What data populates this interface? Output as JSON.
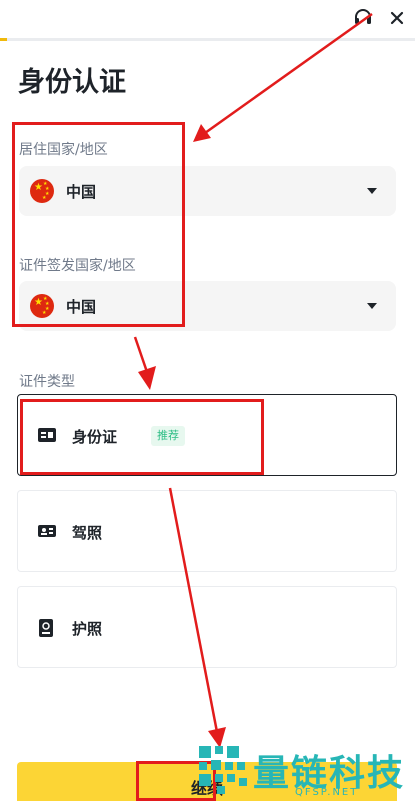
{
  "header": {
    "support_icon": "headset-icon",
    "close_icon": "close-icon",
    "progress_fraction": 0.02
  },
  "page": {
    "title": "身份认证"
  },
  "residence": {
    "label": "居住国家/地区",
    "value": "中国",
    "flag_icon": "china-flag-icon"
  },
  "issuing": {
    "label": "证件签发国家/地区",
    "value": "中国",
    "flag_icon": "china-flag-icon"
  },
  "doc_type": {
    "label": "证件类型",
    "options": [
      {
        "label": "身份证",
        "icon": "id-card-icon",
        "badge": "推荐",
        "selected": true
      },
      {
        "label": "驾照",
        "icon": "driver-license-icon",
        "selected": false
      },
      {
        "label": "护照",
        "icon": "passport-icon",
        "selected": false
      }
    ]
  },
  "footer": {
    "continue_label": "继续"
  },
  "watermark": {
    "text": "量链科技",
    "sub": "QFSP.NET"
  },
  "colors": {
    "accent": "#fcd535",
    "annotation": "#e21c1c",
    "badge_text": "#2ebd85",
    "watermark": "#27b6b6"
  }
}
